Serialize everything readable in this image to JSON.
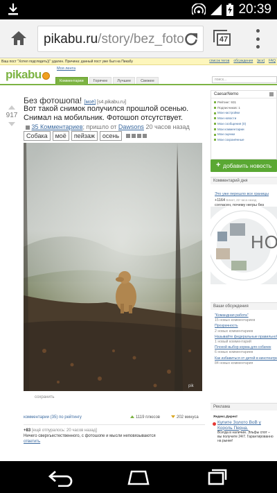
{
  "status_bar": {
    "time": "20:39"
  },
  "browser": {
    "url_host": "pikabu.ru",
    "url_path": "/story/bez_fotos",
    "tab_count": "47"
  },
  "site": {
    "notice": "Ваш пост \"Хотел подглядеть))\" удален. Причина: данный пост уже был на Пикабу",
    "top_links": [
      "список тегов",
      "обсуждения",
      "[все]",
      "FAQ"
    ],
    "my_feed": "Моя лента",
    "logo": "pikabu",
    "nav_tabs": [
      {
        "label": "Комментарии",
        "active": true
      },
      {
        "label": "Горячее",
        "active": false
      },
      {
        "label": "Лучшее",
        "active": false
      },
      {
        "label": "Свежее",
        "active": false
      }
    ],
    "search_placeholder": "поиск..."
  },
  "post": {
    "rating": "917",
    "title": "Без фотошопа!",
    "title_mine": "[моё]",
    "title_source": "[s4.pikabu.ru]",
    "text": "Вот такой снимок получился прошлой осенью. Снимал на мобильник. Фотошоп отсутствует.",
    "comments_link": "35 Комментариев",
    "from_prefix": "; пришло от",
    "author": "Dawsons",
    "age": "20 часов назад",
    "tags": [
      "Собака",
      "моё",
      "пейзаж",
      "осень"
    ],
    "favorite": "сохранить",
    "footer_comments": "комментарии (35) по рейтингу",
    "pluses": "1119 плюсов",
    "minuses": "202 минуса",
    "comment": {
      "rating": "+83",
      "meta": "[ещё отпуралось: 20 часов назад]",
      "text": "Ничего сверхъестественного, с фотошопе и мысли неповязываются",
      "reply": "ответить"
    }
  },
  "sidebar": {
    "username": "CaesarNemo",
    "user_items": [
      {
        "label": "Рейтинг: 931",
        "link": false
      },
      {
        "label": "Подписчиков: 1",
        "link": false
      },
      {
        "label": "Мои настройки",
        "link": true
      },
      {
        "label": "Мои новости",
        "link": true
      },
      {
        "label": "Мои сообщения (0)",
        "link": true
      },
      {
        "label": "Мои комментарии",
        "link": true
      },
      {
        "label": "Мои оценки",
        "link": true
      },
      {
        "label": "Мои сохранённые",
        "link": true
      }
    ],
    "add_button": "добавить новость",
    "cod_header": "Комментарий дня",
    "cod_link": "Это уже перешло все границы",
    "cod_rating": "+1164",
    "cod_meta": "Блинт, 22 часа назад",
    "cod_text": "согласен, почему негры без кандидатов",
    "banner_text": "НО",
    "discussions_header": "Ваши обсуждения",
    "discussions": [
      {
        "title": "\"Командная работа\"",
        "count": "15 новых комментариев"
      },
      {
        "title": "Прозрачность",
        "count": "2 новых комментариев"
      },
      {
        "title": "Называйте федеральные правильно!",
        "count": "1 новый комментарий"
      },
      {
        "title": "Плохой выбор корма для собачек",
        "count": "6 новых комментариев"
      },
      {
        "title": "Как избавиться от детей в кинотеатре",
        "count": "84 новых комментария"
      }
    ],
    "ads_header": "Реклама",
    "ads_label": "Яндекс.Директ",
    "ad_title": "Купите Золото ВоВ у Король Перна.",
    "ad_text": "Всегда в наличии. Эльфы спот – вы получите 24/7. Гарантированно на рынке!"
  }
}
